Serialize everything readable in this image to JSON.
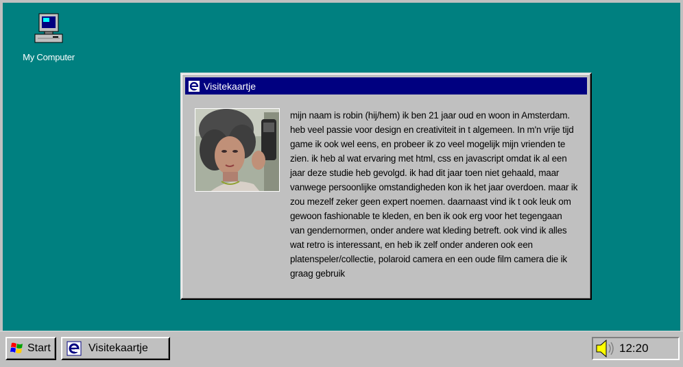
{
  "desktop": {
    "icons": [
      {
        "label": "My Computer",
        "icon": "my-computer-icon"
      }
    ]
  },
  "window": {
    "title": "Visitekaartje",
    "bio": "mijn naam is robin (hij/hem) ik ben 21 jaar oud en woon in Amsterdam. heb veel passie voor design en creativiteit in t algemeen. In m'n vrije tijd game ik ook wel eens, en probeer ik zo veel mogelijk mijn vrienden te zien. ik heb al wat ervaring met html, css en javascript omdat ik al een jaar deze studie heb gevolgd. ik had dit jaar toen niet gehaald, maar vanwege persoonlijke omstandigheden kon ik het jaar overdoen. maar ik zou mezelf zeker geen expert noemen. daarnaast vind ik t ook leuk om gewoon fashionable te kleden, en ben ik ook erg voor het tegengaan van gendernormen, onder andere wat kleding betreft. ook vind ik alles wat retro is interessant, en heb ik zelf onder anderen ook een platenspeler/collectie, polaroid camera en een oude film camera die ik graag gebruik"
  },
  "taskbar": {
    "start_label": "Start",
    "task_label": "Visitekaartje",
    "clock": "12:20"
  },
  "colors": {
    "desktop": "#008080",
    "titlebar": "#000080",
    "face": "#c0c0c0"
  }
}
